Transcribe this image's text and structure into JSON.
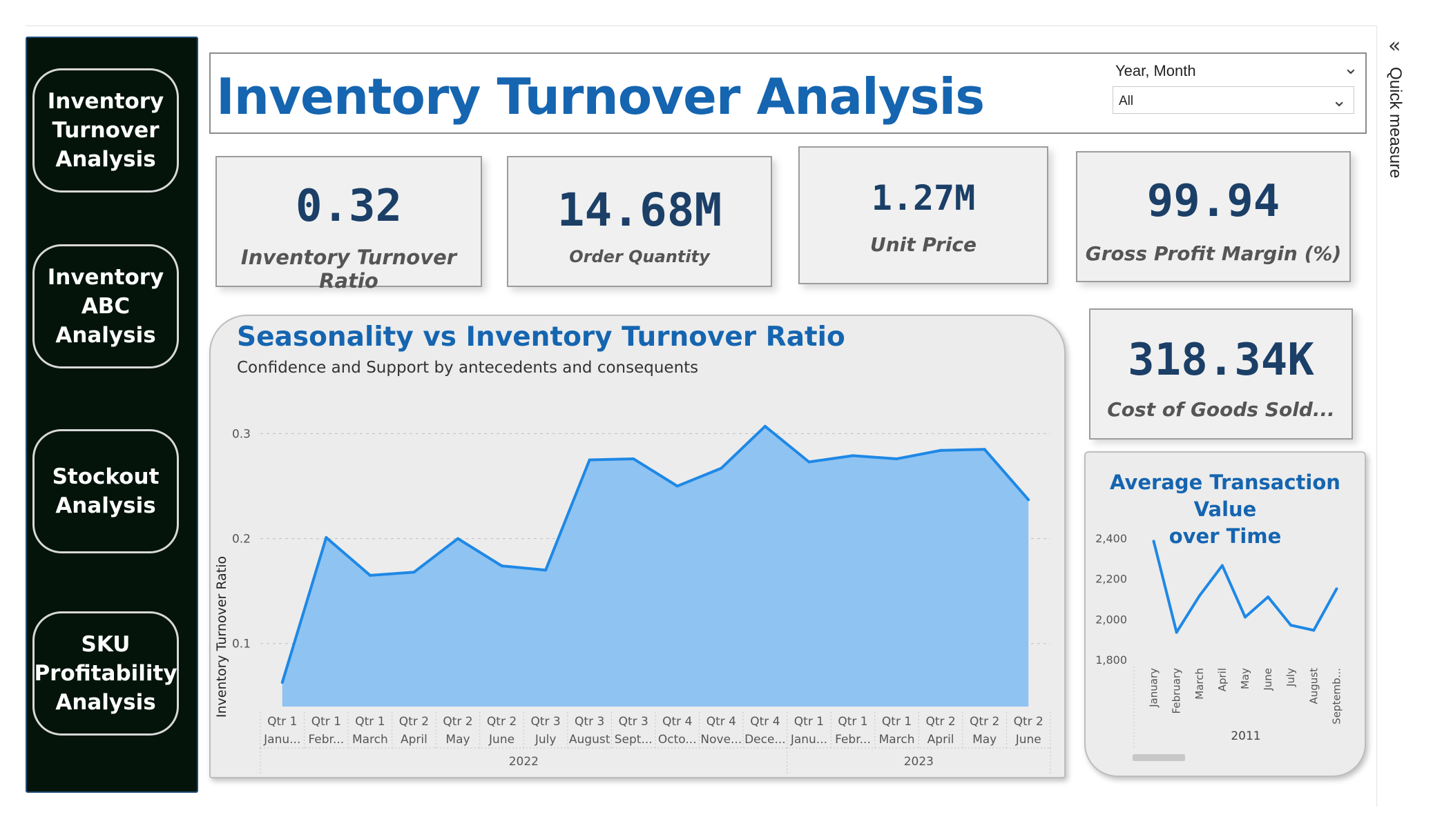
{
  "sidebar": {
    "items": [
      {
        "label": "Inventory\nTurnover\nAnalysis"
      },
      {
        "label": "Inventory\nABC\nAnalysis"
      },
      {
        "label": "Stockout\nAnalysis"
      },
      {
        "label": "SKU\nProfitability\nAnalysis"
      }
    ]
  },
  "header": {
    "title": "Inventory Turnover Analysis",
    "slicer_label": "Year, Month",
    "slicer_value": "All"
  },
  "kpis": {
    "turnover": {
      "value": "0.32",
      "label": "Inventory Turnover Ratio"
    },
    "order_qty": {
      "value": "14.68M",
      "label": "Order Quantity"
    },
    "unit_price": {
      "value": "1.27M",
      "label": "Unit Price"
    },
    "gross_margin": {
      "value": "99.94",
      "label": "Gross Profit Margin (%)"
    },
    "cogs": {
      "value": "318.34K",
      "label": "Cost of Goods Sold..."
    }
  },
  "quick_measure": {
    "label": "Quick measure",
    "icon": "double-chevron-left-icon"
  },
  "colors": {
    "accent": "#1565b0",
    "area_fill": "#8fc3f2",
    "line": "#1e88e5",
    "sidebar_bg": "#04140b"
  },
  "chart_data": [
    {
      "type": "area",
      "title": "Seasonality vs Inventory Turnover Ratio",
      "subtitle": "Confidence and Support by antecedents and consequents",
      "ylabel": "Inventory Turnover Ratio",
      "ylim": [
        0.04,
        0.32
      ],
      "yticks": [
        "0.3",
        "0.2",
        "0.1"
      ],
      "ytick_values": [
        0.3,
        0.2,
        0.1
      ],
      "grid": true,
      "x_quarters": [
        "Qtr 1",
        "Qtr 1",
        "Qtr 1",
        "Qtr 2",
        "Qtr 2",
        "Qtr 2",
        "Qtr 3",
        "Qtr 3",
        "Qtr 3",
        "Qtr 4",
        "Qtr 4",
        "Qtr 4",
        "Qtr 1",
        "Qtr 1",
        "Qtr 1",
        "Qtr 2",
        "Qtr 2",
        "Qtr 2"
      ],
      "x_months": [
        "Janu...",
        "Febr...",
        "March",
        "April",
        "May",
        "June",
        "July",
        "August",
        "Sept...",
        "Octo...",
        "Nove...",
        "Dece...",
        "Janu...",
        "Febr...",
        "March",
        "April",
        "May",
        "June"
      ],
      "years": [
        {
          "label": "2022",
          "count": 12
        },
        {
          "label": "2023",
          "count": 6
        }
      ],
      "values": [
        0.063,
        0.201,
        0.165,
        0.168,
        0.2,
        0.174,
        0.17,
        0.275,
        0.276,
        0.25,
        0.267,
        0.307,
        0.273,
        0.279,
        0.276,
        0.284,
        0.285,
        0.237
      ]
    },
    {
      "type": "line",
      "title": "Average Transaction Value\nover Time",
      "ylim": [
        1800,
        2400
      ],
      "yticks": [
        "2,400",
        "2,200",
        "2,000",
        "1,800"
      ],
      "ytick_values": [
        2400,
        2200,
        2000,
        1800
      ],
      "categories": [
        "January",
        "February",
        "March",
        "April",
        "May",
        "June",
        "July",
        "August",
        "Septemb..."
      ],
      "xlabel": "2011",
      "values": [
        2385,
        1935,
        2115,
        2265,
        2010,
        2110,
        1970,
        1945,
        2150
      ]
    }
  ]
}
